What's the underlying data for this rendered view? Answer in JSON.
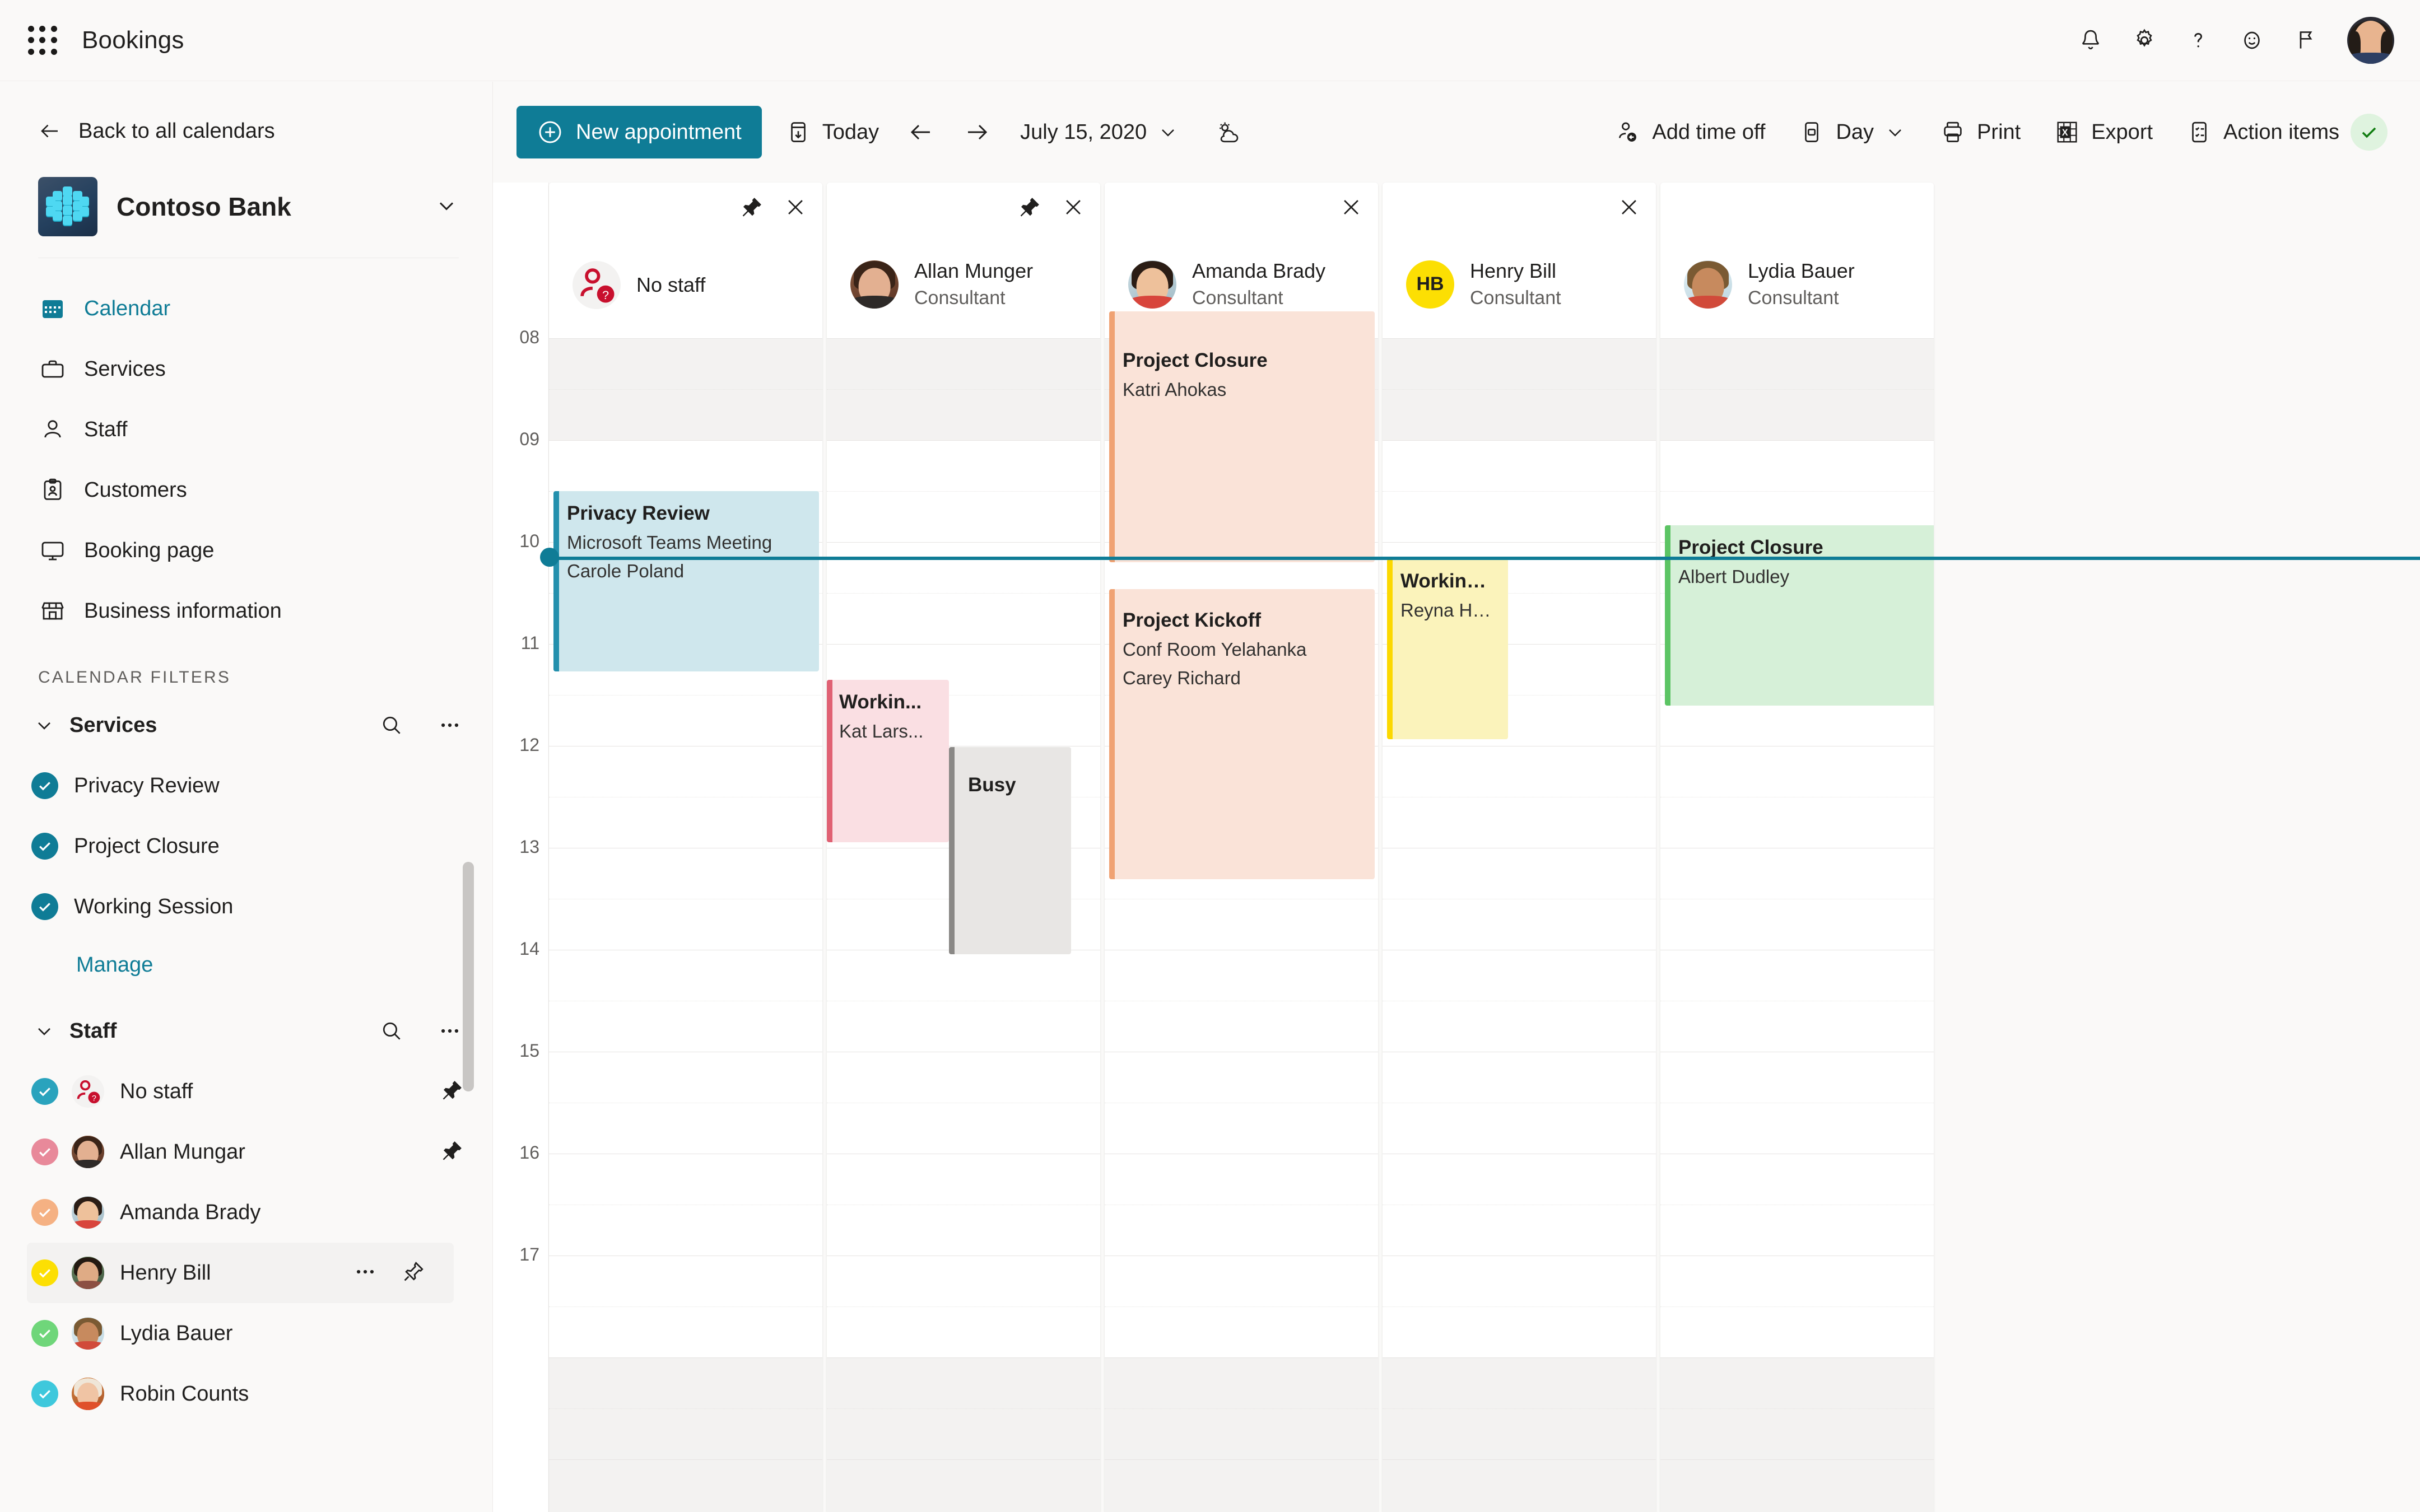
{
  "suite": {
    "app_title": "Bookings",
    "icons": [
      "waffle-icon",
      "notification-bell-icon",
      "gear-icon",
      "help-icon",
      "feedback-smiley-icon",
      "flag-icon",
      "user-avatar"
    ]
  },
  "sidebar": {
    "back_label": "Back to all calendars",
    "business_name": "Contoso Bank",
    "nav": [
      {
        "label": "Calendar",
        "icon": "calendar-icon",
        "active": true
      },
      {
        "label": "Services",
        "icon": "briefcase-icon",
        "active": false
      },
      {
        "label": "Staff",
        "icon": "person-icon",
        "active": false
      },
      {
        "label": "Customers",
        "icon": "clipboard-person-icon",
        "active": false
      },
      {
        "label": "Booking page",
        "icon": "monitor-icon",
        "active": false
      },
      {
        "label": "Business information",
        "icon": "storefront-icon",
        "active": false
      }
    ],
    "filters_title": "Calendar filters",
    "services_group": {
      "label": "Services",
      "items": [
        {
          "label": "Privacy Review",
          "color": "#0f7c96"
        },
        {
          "label": "Project Closure",
          "color": "#0f7c96"
        },
        {
          "label": "Working Session",
          "color": "#0f7c96"
        }
      ],
      "manage_label": "Manage"
    },
    "staff_group": {
      "label": "Staff",
      "items": [
        {
          "label": "No staff",
          "color": "#2aa3bd",
          "pinned": true,
          "selected": false,
          "avatar": "no-staff-icon"
        },
        {
          "label": "Allan Mungar",
          "color": "#e8899a",
          "pinned": true,
          "selected": false,
          "avatar": "photo"
        },
        {
          "label": "Amanda Brady",
          "color": "#f5b183",
          "pinned": false,
          "selected": false,
          "avatar": "photo"
        },
        {
          "label": "Henry Bill",
          "color": "#fcdf03",
          "pinned": false,
          "selected": true,
          "avatar": "photo"
        },
        {
          "label": "Lydia Bauer",
          "color": "#6fd67a",
          "pinned": false,
          "selected": false,
          "avatar": "photo"
        },
        {
          "label": "Robin Counts",
          "color": "#3ec8dc",
          "pinned": false,
          "selected": false,
          "avatar": "photo"
        }
      ]
    }
  },
  "toolbar": {
    "new_appointment": "New appointment",
    "today": "Today",
    "date": "July 15, 2020",
    "add_time_off": "Add time off",
    "view": "Day",
    "print": "Print",
    "export": "Export",
    "action_items": "Action items"
  },
  "calendar": {
    "hours": [
      "08",
      "09",
      "10",
      "11",
      "12",
      "13",
      "14",
      "15",
      "16",
      "17"
    ],
    "current_time_position": "10:00",
    "columns": [
      {
        "name": "No staff",
        "role": "",
        "avatar": "no-staff-icon",
        "pinned": true,
        "closable": true,
        "initials": ""
      },
      {
        "name": "Allan Munger",
        "role": "Consultant",
        "avatar": "photo",
        "pinned": true,
        "closable": true,
        "initials": ""
      },
      {
        "name": "Amanda Brady",
        "role": "Consultant",
        "avatar": "photo",
        "pinned": false,
        "closable": true,
        "initials": ""
      },
      {
        "name": "Henry Bill",
        "role": "Consultant",
        "avatar": "initials",
        "pinned": false,
        "closable": true,
        "initials": "HB",
        "initials_bg": "#fcdf03"
      },
      {
        "name": "Lydia Bauer",
        "role": "Consultant",
        "avatar": "photo",
        "pinned": false,
        "closable": false,
        "initials": ""
      }
    ],
    "events": [
      {
        "col": 0,
        "title": "Privacy Review",
        "line2": "Microsoft Teams Meeting",
        "line3": "Carole Poland",
        "start": "08:30",
        "end": "10:15",
        "bg": "#cfe7ed",
        "bar": "#2490ad"
      },
      {
        "col": 1,
        "title": "Workin...",
        "line2": "Kat Lars...",
        "line3": "",
        "start": "11:20",
        "end": "12:55",
        "bg": "#fadfe3",
        "bar": "#e06173"
      },
      {
        "col": 1,
        "title": "Busy",
        "line2": "",
        "line3": "",
        "start": "11:55",
        "end": "14:00",
        "bg": "#e8e6e4",
        "bar": "#8a8886",
        "busy": true
      },
      {
        "col": 2,
        "title": "Project Closure",
        "line2": "Katri Ahokas",
        "line3": "",
        "start": "07:40",
        "end": "09:55",
        "bg": "#fae3d8",
        "bar": "#f0a273"
      },
      {
        "col": 2,
        "title": "Project Kickoff",
        "line2": "Conf Room Yelahanka",
        "line3": "Carey Richard",
        "start": "09:55",
        "end": "12:45",
        "bg": "#fae3d8",
        "bar": "#f0a273"
      },
      {
        "col": 3,
        "title": "Working Session",
        "line2": "Reyna Holman",
        "line3": "",
        "start": "09:35",
        "end": "11:20",
        "bg": "#fbf3bb",
        "bar": "#fcd800"
      },
      {
        "col": 4,
        "title": "Project Closure",
        "line2": "Albert Dudley",
        "line3": "",
        "start": "09:15",
        "end": "11:00",
        "bg": "#d6f0d8",
        "bar": "#5cc464"
      }
    ]
  }
}
